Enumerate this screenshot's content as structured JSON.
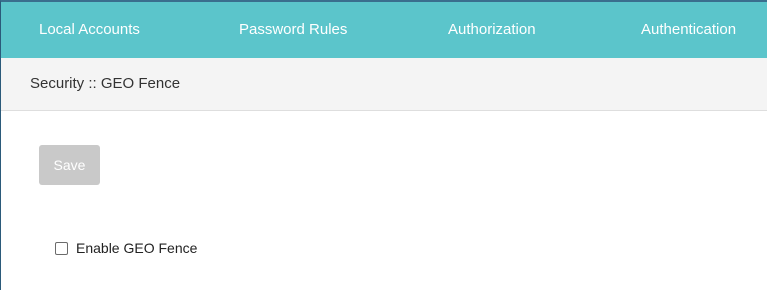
{
  "tabs": [
    {
      "label": "Local Accounts"
    },
    {
      "label": "Password Rules"
    },
    {
      "label": "Authorization"
    },
    {
      "label": "Authentication"
    }
  ],
  "breadcrumb": "Security :: GEO Fence",
  "toolbar": {
    "save_label": "Save"
  },
  "geo_fence": {
    "enable_label": "Enable GEO Fence",
    "enabled": false
  },
  "colors": {
    "tab_bar": "#5bc5cb",
    "breadcrumb_bar": "#f4f4f4",
    "save_button_disabled": "#c9c9c9"
  }
}
